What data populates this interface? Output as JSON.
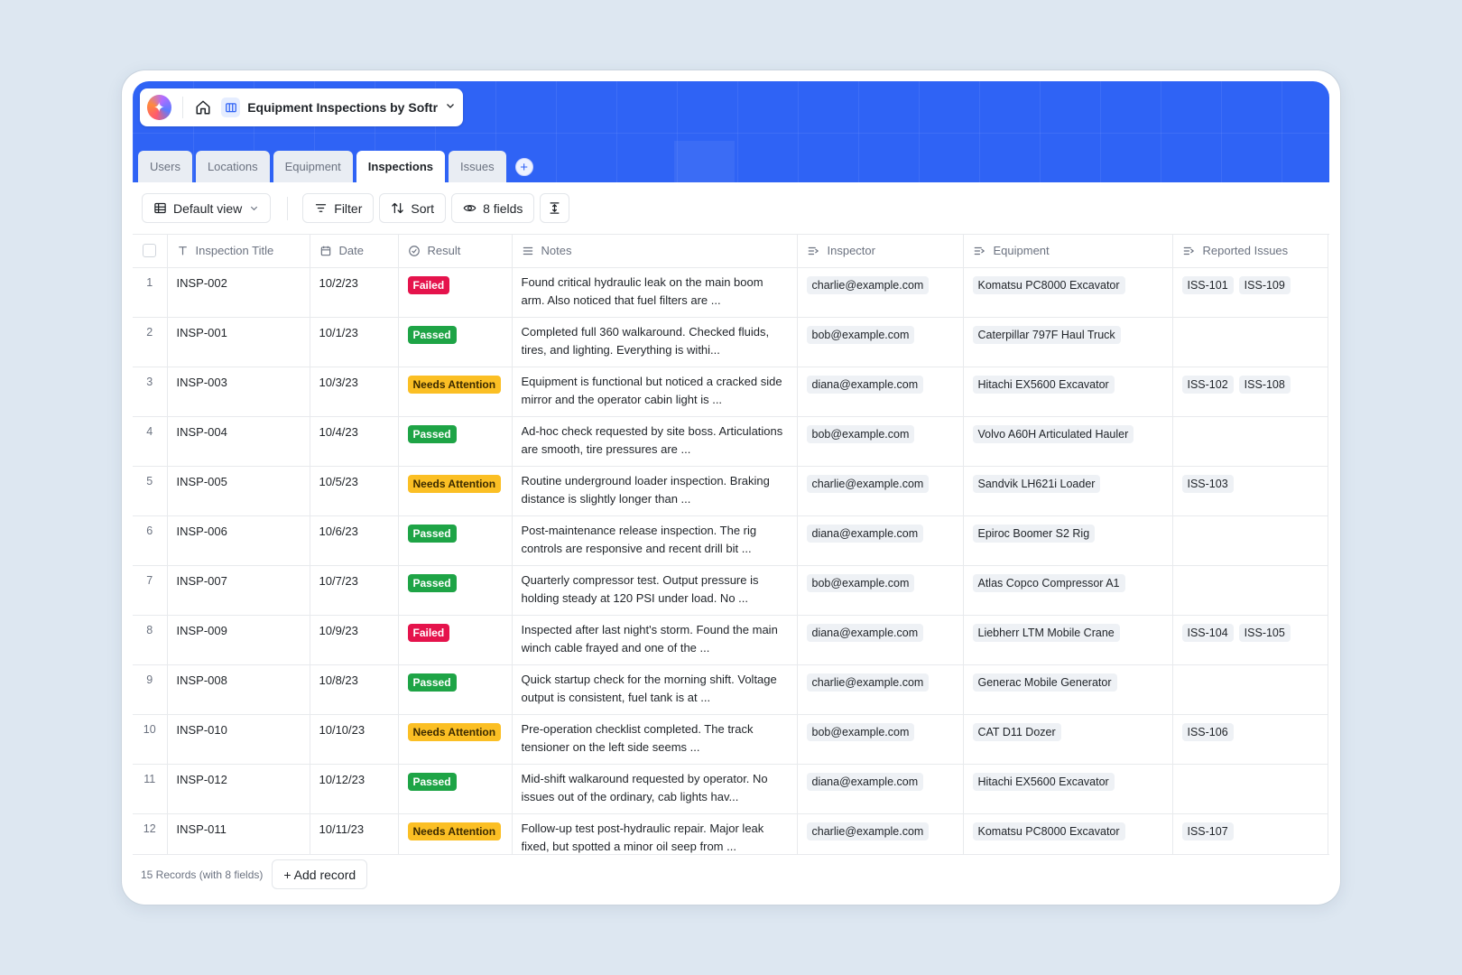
{
  "app": {
    "title": "Equipment Inspections by Softr"
  },
  "tabs": [
    {
      "label": "Users",
      "active": false
    },
    {
      "label": "Locations",
      "active": false
    },
    {
      "label": "Equipment",
      "active": false
    },
    {
      "label": "Inspections",
      "active": true
    },
    {
      "label": "Issues",
      "active": false
    }
  ],
  "toolbar": {
    "view_label": "Default view",
    "filter_label": "Filter",
    "sort_label": "Sort",
    "fields_label": "8 fields"
  },
  "columns": {
    "title": "Inspection Title",
    "date": "Date",
    "result": "Result",
    "notes": "Notes",
    "inspector": "Inspector",
    "equipment": "Equipment",
    "issues": "Reported Issues"
  },
  "rows": [
    {
      "num": "1",
      "title": "INSP-002",
      "date": "10/2/23",
      "result": "Failed",
      "notes": "Found critical hydraulic leak on the main boom arm. Also noticed that fuel filters are ...",
      "inspector": "charlie@example.com",
      "equipment": "Komatsu PC8000 Excavator",
      "issues": [
        "ISS-101",
        "ISS-109"
      ]
    },
    {
      "num": "2",
      "title": "INSP-001",
      "date": "10/1/23",
      "result": "Passed",
      "notes": "Completed full 360 walkaround. Checked fluids, tires, and lighting. Everything is withi...",
      "inspector": "bob@example.com",
      "equipment": "Caterpillar 797F Haul Truck",
      "issues": []
    },
    {
      "num": "3",
      "title": "INSP-003",
      "date": "10/3/23",
      "result": "Needs Attention",
      "notes": "Equipment is functional but noticed a cracked side mirror and the operator cabin light is ...",
      "inspector": "diana@example.com",
      "equipment": "Hitachi EX5600 Excavator",
      "issues": [
        "ISS-102",
        "ISS-108"
      ]
    },
    {
      "num": "4",
      "title": "INSP-004",
      "date": "10/4/23",
      "result": "Passed",
      "notes": "Ad-hoc check requested by site boss. Articulations are smooth, tire pressures are ...",
      "inspector": "bob@example.com",
      "equipment": "Volvo A60H Articulated Hauler",
      "issues": []
    },
    {
      "num": "5",
      "title": "INSP-005",
      "date": "10/5/23",
      "result": "Needs Attention",
      "notes": "Routine underground loader inspection. Braking distance is slightly longer than ...",
      "inspector": "charlie@example.com",
      "equipment": "Sandvik LH621i Loader",
      "issues": [
        "ISS-103"
      ]
    },
    {
      "num": "6",
      "title": "INSP-006",
      "date": "10/6/23",
      "result": "Passed",
      "notes": "Post-maintenance release inspection. The rig controls are responsive and recent drill bit ...",
      "inspector": "diana@example.com",
      "equipment": "Epiroc Boomer S2 Rig",
      "issues": []
    },
    {
      "num": "7",
      "title": "INSP-007",
      "date": "10/7/23",
      "result": "Passed",
      "notes": "Quarterly compressor test. Output pressure is holding steady at 120 PSI under load. No ...",
      "inspector": "bob@example.com",
      "equipment": "Atlas Copco Compressor A1",
      "issues": []
    },
    {
      "num": "8",
      "title": "INSP-009",
      "date": "10/9/23",
      "result": "Failed",
      "notes": "Inspected after last night's storm. Found the main winch cable frayed and one of the ...",
      "inspector": "diana@example.com",
      "equipment": "Liebherr LTM Mobile Crane",
      "issues": [
        "ISS-104",
        "ISS-105"
      ]
    },
    {
      "num": "9",
      "title": "INSP-008",
      "date": "10/8/23",
      "result": "Passed",
      "notes": "Quick startup check for the morning shift. Voltage output is consistent, fuel tank is at ...",
      "inspector": "charlie@example.com",
      "equipment": "Generac Mobile Generator",
      "issues": []
    },
    {
      "num": "10",
      "title": "INSP-010",
      "date": "10/10/23",
      "result": "Needs Attention",
      "notes": "Pre-operation checklist completed. The track tensioner on the left side seems ...",
      "inspector": "bob@example.com",
      "equipment": "CAT D11 Dozer",
      "issues": [
        "ISS-106"
      ]
    },
    {
      "num": "11",
      "title": "INSP-012",
      "date": "10/12/23",
      "result": "Passed",
      "notes": "Mid-shift walkaround requested by operator. No issues out of the ordinary, cab lights hav...",
      "inspector": "diana@example.com",
      "equipment": "Hitachi EX5600 Excavator",
      "issues": []
    },
    {
      "num": "12",
      "title": "INSP-011",
      "date": "10/11/23",
      "result": "Needs Attention",
      "notes": "Follow-up test post-hydraulic repair. Major leak fixed, but spotted a minor oil seep from ...",
      "inspector": "charlie@example.com",
      "equipment": "Komatsu PC8000 Excavator",
      "issues": [
        "ISS-107"
      ]
    }
  ],
  "footer": {
    "records_label": "15 Records (with 8 fields)",
    "add_record_label": "+ Add record"
  },
  "colors": {
    "accent": "#2f63f5",
    "failed": "#e5134c",
    "passed": "#1ea446",
    "attention": "#fbbf24"
  }
}
